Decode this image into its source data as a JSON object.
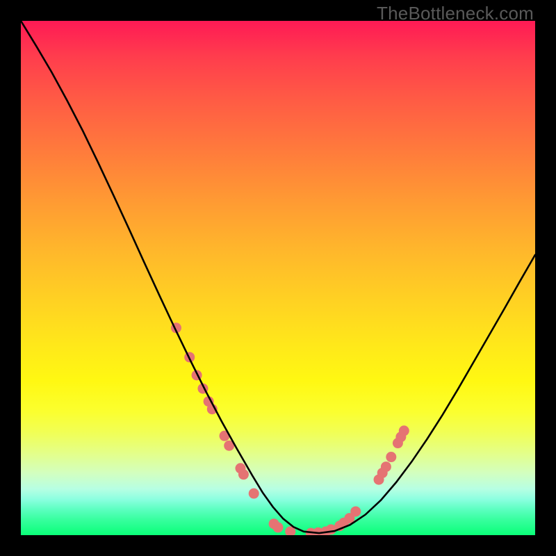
{
  "watermark": "TheBottleneck.com",
  "chart_data": {
    "type": "line",
    "title": "",
    "xlabel": "",
    "ylabel": "",
    "xlim": [
      0,
      100
    ],
    "ylim": [
      0,
      100
    ],
    "grid": false,
    "series": [
      {
        "name": "curve",
        "x": [
          0,
          3,
          6,
          9,
          12,
          15,
          18,
          21,
          24,
          27,
          30,
          33,
          36,
          39,
          42,
          45,
          47,
          49,
          51,
          53,
          55,
          58,
          61,
          64,
          67,
          70,
          73,
          76,
          79,
          82,
          85,
          88,
          91,
          94,
          97,
          100
        ],
        "y": [
          100,
          95.1,
          90,
          84.5,
          78.7,
          72.5,
          66.1,
          59.6,
          53,
          46.5,
          40.1,
          33.9,
          27.9,
          22.2,
          16.8,
          11.6,
          8.3,
          5.5,
          3.2,
          1.6,
          0.7,
          0.4,
          0.8,
          2,
          4,
          6.8,
          10.3,
          14.3,
          18.7,
          23.4,
          28.4,
          33.6,
          38.8,
          44,
          49.3,
          54.5
        ]
      }
    ],
    "markers": [
      {
        "x": 30.2,
        "y": 40.3
      },
      {
        "x": 32.8,
        "y": 34.6
      },
      {
        "x": 34.2,
        "y": 31.1
      },
      {
        "x": 35.4,
        "y": 28.5
      },
      {
        "x": 36.5,
        "y": 26.0
      },
      {
        "x": 37.2,
        "y": 24.5
      },
      {
        "x": 39.6,
        "y": 19.3
      },
      {
        "x": 40.5,
        "y": 17.4
      },
      {
        "x": 42.7,
        "y": 13.0
      },
      {
        "x": 43.3,
        "y": 11.8
      },
      {
        "x": 45.3,
        "y": 8.1
      },
      {
        "x": 49.2,
        "y": 2.2
      },
      {
        "x": 50.0,
        "y": 1.5
      },
      {
        "x": 52.4,
        "y": 0.7
      },
      {
        "x": 56.4,
        "y": 0.4
      },
      {
        "x": 57.8,
        "y": 0.5
      },
      {
        "x": 59.3,
        "y": 0.7
      },
      {
        "x": 60.3,
        "y": 1.1
      },
      {
        "x": 62.0,
        "y": 1.8
      },
      {
        "x": 62.8,
        "y": 2.4
      },
      {
        "x": 63.9,
        "y": 3.3
      },
      {
        "x": 65.1,
        "y": 4.6
      },
      {
        "x": 69.6,
        "y": 10.8
      },
      {
        "x": 70.3,
        "y": 12.1
      },
      {
        "x": 71.0,
        "y": 13.3
      },
      {
        "x": 72.0,
        "y": 15.2
      },
      {
        "x": 73.3,
        "y": 17.9
      },
      {
        "x": 73.9,
        "y": 19.1
      },
      {
        "x": 74.5,
        "y": 20.3
      }
    ],
    "marker_color": "#e57373",
    "marker_radius": 7.5
  }
}
